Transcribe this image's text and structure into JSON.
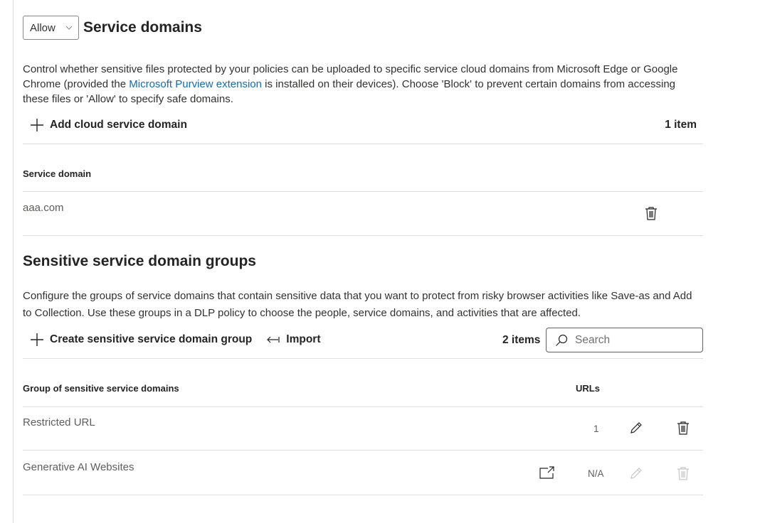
{
  "service_domains": {
    "action_select": {
      "value": "Allow"
    },
    "title": "Service domains",
    "description": {
      "before_link": "Control whether sensitive files protected by your policies can be uploaded to specific service cloud domains from Microsoft Edge or Google Chrome (provided the ",
      "link": "Microsoft Purview extension",
      "after_link": " is installed on their devices). Choose 'Block' to prevent certain domains from accessing these files or 'Allow' to specify safe domains."
    },
    "add_button_label": "Add cloud service domain",
    "item_count": "1 item",
    "table": {
      "column_header": "Service domain",
      "rows": [
        {
          "domain": "aaa.com"
        }
      ]
    }
  },
  "sensitive_groups": {
    "title": "Sensitive service domain groups",
    "description": "Configure the groups of service domains that contain sensitive data that you want to protect from risky browser activities like Save-as and Add to Collection. Use these groups in a DLP policy to choose the people, service domains, and activities that are affected.",
    "create_button_label": "Create sensitive service domain group",
    "import_button_label": "Import",
    "item_count": "2 items",
    "search": {
      "placeholder": "Search",
      "value": ""
    },
    "table": {
      "columns": {
        "group": "Group of sensitive service domains",
        "urls": "URLs"
      },
      "rows": [
        {
          "name": "Restricted URL",
          "urls": "1",
          "editable": true
        },
        {
          "name": "Generative AI Websites",
          "urls": "N/A",
          "editable": false,
          "has_open_link": true
        }
      ]
    }
  },
  "colors": {
    "link": "#0f6cbd",
    "text": "#242424",
    "muted": "#605e5c",
    "disabled_icon": "#c8c6c4",
    "divider": "#e1dfdd"
  }
}
